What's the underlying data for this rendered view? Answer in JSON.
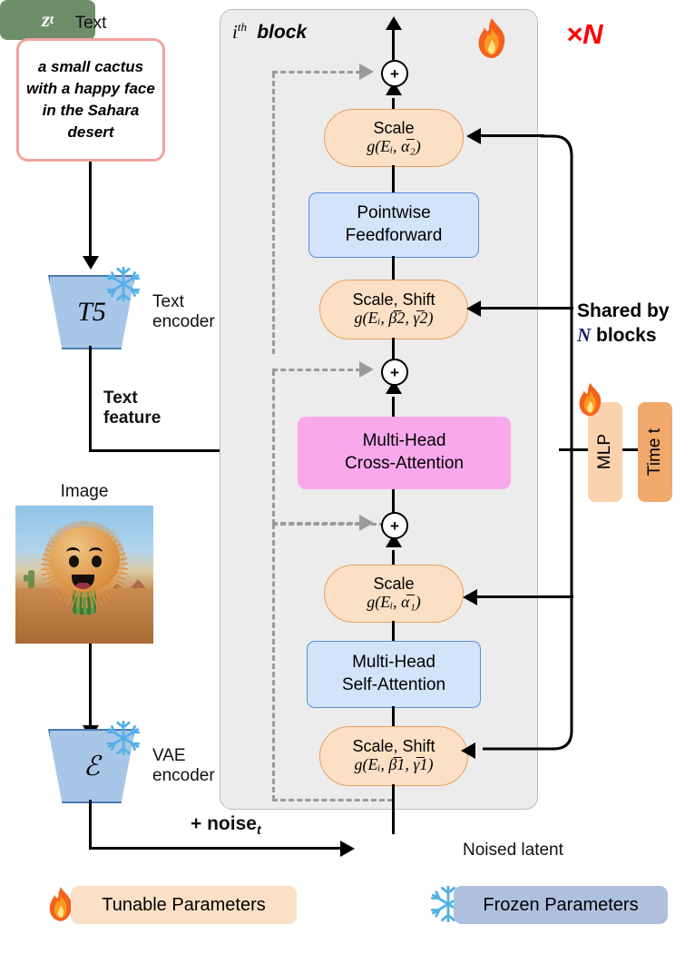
{
  "left_pipeline": {
    "text_caption": "Text",
    "prompt": "a small cactus with a happy face in the Sahara desert",
    "text_encoder_symbol": "T5",
    "text_encoder_label_line1": "Text",
    "text_encoder_label_line2": "encoder",
    "text_feature_line1": "Text",
    "text_feature_line2": "feature",
    "image_caption": "Image",
    "vae_symbol": "ℰ",
    "vae_label_line1": "VAE",
    "vae_label_line2": "encoder",
    "noise_label": "+ noise",
    "noise_sub": "t"
  },
  "block": {
    "title_i": "i",
    "title_th": "th",
    "title_block": "block",
    "repeat_label": "×N",
    "flame_icon": "fire-icon",
    "plus_symbol": "+",
    "nodes": {
      "scale_top": {
        "line1": "Scale",
        "line2": "g(Eᵢ, α̅₂)"
      },
      "pointwise_ff": {
        "line1": "Pointwise",
        "line2": "Feedforward"
      },
      "scale_shift_2": {
        "line1": "Scale, Shift",
        "line2": "g(Eᵢ, β̅2, γ̅2)"
      },
      "cross_attention": {
        "line1": "Multi-Head",
        "line2": "Cross-Attention"
      },
      "scale_1": {
        "line1": "Scale",
        "line2": "g(Eᵢ, α̅₁)"
      },
      "self_attention": {
        "line1": "Multi-Head",
        "line2": "Self-Attention"
      },
      "scale_shift_1": {
        "line1": "Scale, Shift",
        "line2": "g(Eᵢ, β̅1, γ̅1)"
      }
    }
  },
  "conditioning": {
    "shared_line1": "Shared by",
    "shared_line2_n": "N",
    "shared_line2_rest": " blocks",
    "mlp_label": "MLP",
    "time_label": "Time t",
    "flame_icon": "fire-icon"
  },
  "latent": {
    "zt_label": "z",
    "zt_sub": "t",
    "noised_latent_label": "Noised latent"
  },
  "legend": {
    "tunable": {
      "icon": "fire-icon",
      "label": "Tunable Parameters"
    },
    "frozen": {
      "icon": "snowflake-icon",
      "label": "Frozen Parameters"
    }
  },
  "colors": {
    "prompt_border": "#F2A3A0",
    "encoder_fill": "#A8C6E8",
    "encoder_stroke": "#4B78B0",
    "block_fill": "#ECECEC",
    "pill_fill": "#FCE0C6",
    "pill_stroke": "#E8A05C",
    "blue_fill": "#D3E3FA",
    "blue_stroke": "#5B8FD6",
    "pink_fill": "#F9A8EC",
    "mlp_fill": "#FAD3AE",
    "time_fill": "#F0A96B",
    "latent_fill": "#6E8E6A",
    "repeat_color": "#FF0000",
    "dashed_gray": "#9A9A9A"
  }
}
